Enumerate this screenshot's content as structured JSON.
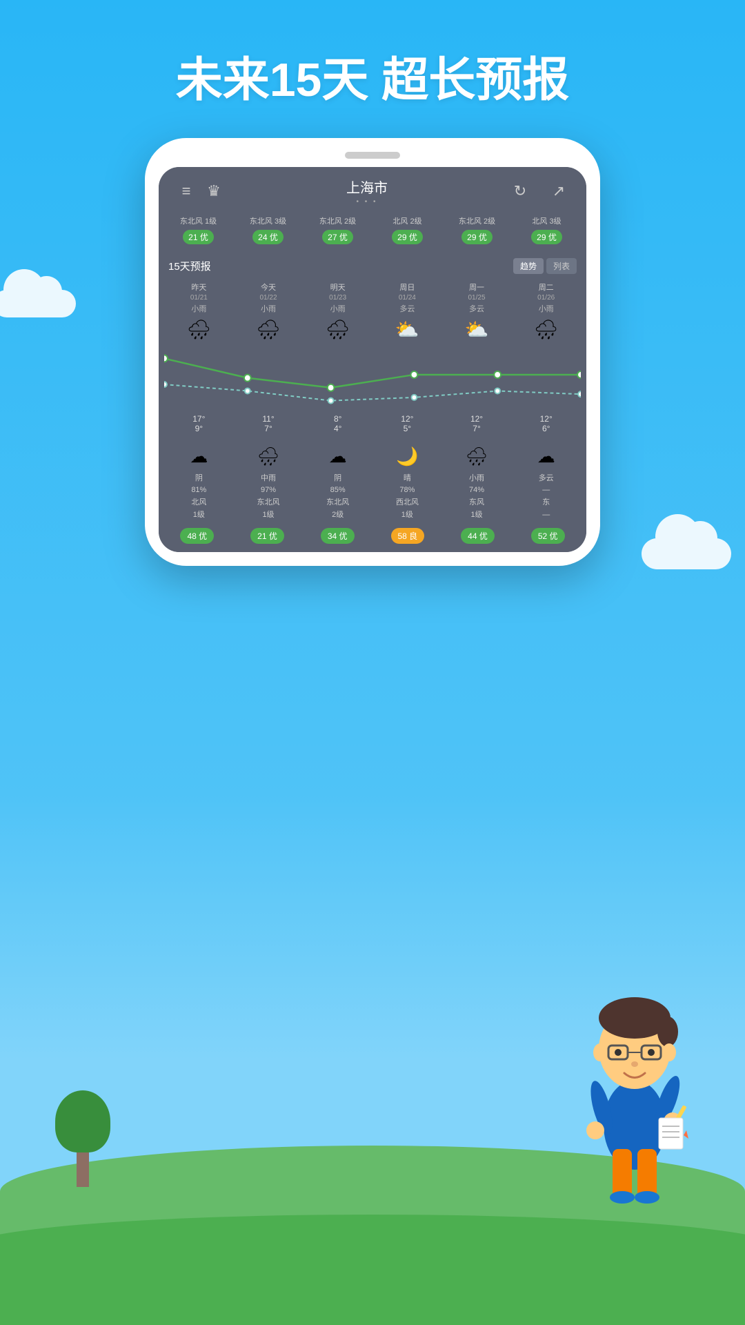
{
  "headline": "未来15天  超长预报",
  "background_color": "#29b6f6",
  "app": {
    "city": "上海市",
    "dots": "• • •",
    "forecast_label": "15天预报",
    "tab_trend": "趋势",
    "tab_list": "列表",
    "header": {
      "menu_icon": "≡",
      "crown_icon": "♛",
      "refresh_icon": "↻",
      "share_icon": "↗"
    }
  },
  "aqi_row": [
    {
      "wind": "东北风\n1级",
      "aqi": "21 优",
      "type": "good"
    },
    {
      "wind": "东北风\n3级",
      "aqi": "24 优",
      "type": "good"
    },
    {
      "wind": "东北风\n2级",
      "aqi": "27 优",
      "type": "good"
    },
    {
      "wind": "北风\n2级",
      "aqi": "29 优",
      "type": "good"
    },
    {
      "wind": "东北风\n2级",
      "aqi": "29 优",
      "type": "good"
    },
    {
      "wind": "北风\n3级",
      "aqi": "29 优",
      "type": "good"
    }
  ],
  "days": [
    {
      "label": "昨天",
      "date": "01/21",
      "weather": "小雨",
      "icon": "🌧",
      "high": "17°",
      "low": "9°",
      "night_icon": "☁",
      "detail": "阴\n81%\n北风\n1级",
      "aqi": "48 优",
      "aqi_type": "good"
    },
    {
      "label": "今天",
      "date": "01/22",
      "weather": "小雨",
      "icon": "🌧",
      "high": "11°",
      "low": "7°",
      "night_icon": "🌧",
      "detail": "中雨\n97%\n东北风\n1级",
      "aqi": "21 优",
      "aqi_type": "good"
    },
    {
      "label": "明天",
      "date": "01/23",
      "weather": "小雨",
      "icon": "🌧",
      "high": "8°",
      "low": "4°",
      "night_icon": "☁",
      "detail": "阴\n85%\n东北风\n2级",
      "aqi": "34 优",
      "aqi_type": "good"
    },
    {
      "label": "周日",
      "date": "01/24",
      "weather": "多云",
      "icon": "⛅",
      "high": "12°",
      "low": "5°",
      "night_icon": "🌙",
      "detail": "晴\n78%\n西北风\n1级",
      "aqi": "58 良",
      "aqi_type": "liang"
    },
    {
      "label": "周一",
      "date": "01/25",
      "weather": "多云",
      "icon": "⛅",
      "high": "12°",
      "low": "7°",
      "night_icon": "🌧",
      "detail": "小雨\n74%\n东风\n1级",
      "aqi": "44 优",
      "aqi_type": "good"
    },
    {
      "label": "周二",
      "date": "01/26",
      "weather": "小雨",
      "icon": "🌧",
      "high": "12°",
      "low": "6°",
      "night_icon": "☁",
      "detail": "多云\n—\n东\n—",
      "aqi": "52 优",
      "aqi_type": "good"
    }
  ],
  "chart": {
    "high_temps": [
      17,
      11,
      8,
      12,
      12,
      12
    ],
    "low_temps": [
      9,
      7,
      4,
      5,
      7,
      6
    ]
  }
}
